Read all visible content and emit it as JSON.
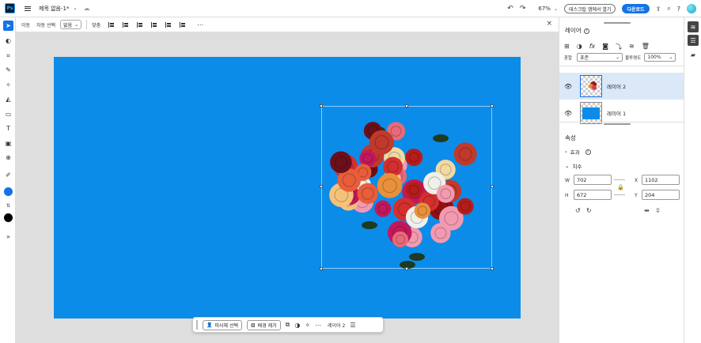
{
  "app": {
    "logo": "Ps",
    "doc_title": "제목 없음-1*",
    "zoom": "67%"
  },
  "topbar": {
    "open_desktop_label": "데스크탑 앱에서 열기",
    "download_label": "다운로드",
    "icons": [
      "menu-icon",
      "cloud-icon",
      "undo-icon",
      "redo-icon",
      "share-icon",
      "search-icon",
      "help-icon"
    ]
  },
  "options": {
    "move_label": "이동",
    "auto_select_label": "자동 선택",
    "select_value": "없음",
    "align_label": "맞춤"
  },
  "taskbar": {
    "select_subject_label": "피사체 선택",
    "remove_bg_label": "배경 제거",
    "layer_label": "레이어 2"
  },
  "layers": {
    "title": "레이어",
    "blend_label": "혼합",
    "blend_value": "표준",
    "opacity_label": "불투명도",
    "opacity_value": "100%",
    "items": [
      {
        "name": "레이어 2",
        "selected": true
      },
      {
        "name": "레이어 1",
        "selected": false
      }
    ]
  },
  "properties": {
    "title": "속성",
    "effects_label": "효과",
    "dimensions_label": "치수",
    "w_label": "W",
    "w_value": "702",
    "h_label": "H",
    "h_value": "672",
    "x_label": "X",
    "x_value": "1102",
    "y_label": "Y",
    "y_value": "204"
  },
  "colors": {
    "canvas": "#0b8ce9",
    "accent": "#1473e6",
    "foreground": "#1473e6",
    "background": "#000000"
  }
}
